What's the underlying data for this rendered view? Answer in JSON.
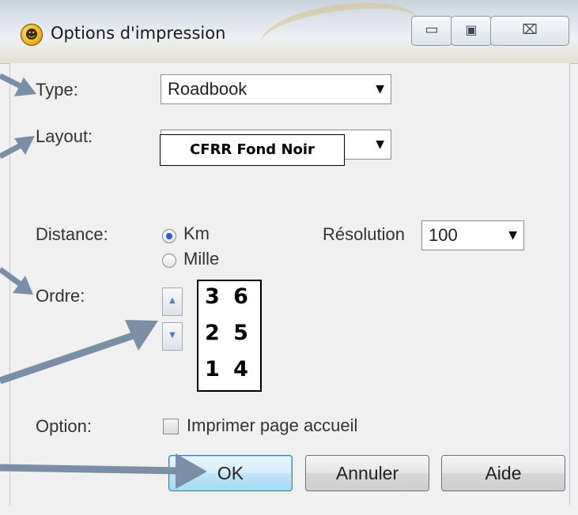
{
  "window": {
    "title": "Options d'impression",
    "controls": {
      "minimize": "▭",
      "maximize": "▣",
      "close": "⌧"
    }
  },
  "form": {
    "type": {
      "label": "Type:",
      "value": "Roadbook"
    },
    "layout": {
      "label": "Layout:",
      "value": "CFRR Fond Noir"
    },
    "distance": {
      "label": "Distance:",
      "options": [
        {
          "label": "Km",
          "selected": true
        },
        {
          "label": "Mille",
          "selected": false
        }
      ]
    },
    "resolution": {
      "label": "Résolution",
      "value": "100"
    },
    "order": {
      "label": "Ordre:",
      "rows": [
        "3 6",
        "2 5",
        "1 4"
      ]
    },
    "option": {
      "label": "Option:",
      "checkbox_label": "Imprimer page accueil",
      "checked": false
    }
  },
  "buttons": {
    "ok": "OK",
    "cancel": "Annuler",
    "help": "Aide"
  },
  "icons": {
    "app": "roadbook-app-icon",
    "dropdown": "chevron-down-icon",
    "spin_up": "spin-up-icon",
    "spin_down": "spin-down-icon"
  },
  "colors": {
    "annotation_arrow": "#7a8fa6",
    "ok_accent": "#3c7fb1",
    "radio_selected": "#2d5cc9"
  }
}
